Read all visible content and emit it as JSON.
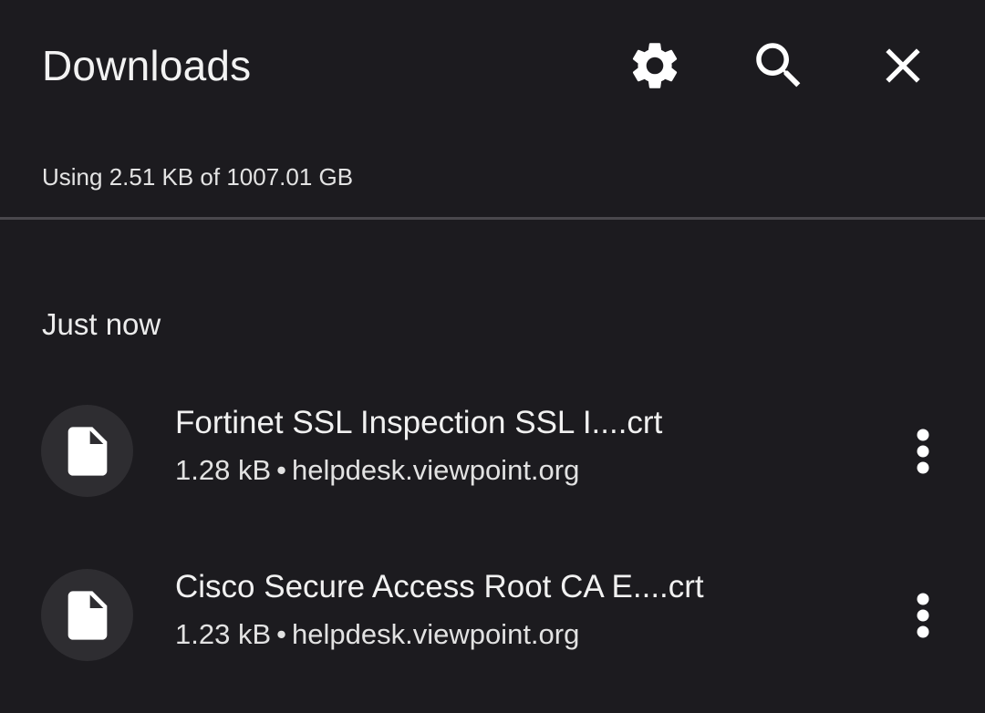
{
  "header": {
    "title": "Downloads",
    "settings_icon": "gear-icon",
    "search_icon": "search-icon",
    "close_icon": "close-icon"
  },
  "storage": {
    "text": "Using 2.51 KB of 1007.01 GB"
  },
  "sections": [
    {
      "label": "Just now",
      "items": [
        {
          "name": "Fortinet SSL Inspection SSL I....crt",
          "size": "1.28 kB",
          "separator": "•",
          "source": "helpdesk.viewpoint.org",
          "icon": "file-icon",
          "menu_icon": "more-vert-icon"
        },
        {
          "name": "Cisco Secure Access Root CA E....crt",
          "size": "1.23 kB",
          "separator": "•",
          "source": "helpdesk.viewpoint.org",
          "icon": "file-icon",
          "menu_icon": "more-vert-icon"
        }
      ]
    }
  ],
  "colors": {
    "background": "#1c1b1f",
    "divider": "#4a484d",
    "avatar": "#2e2d31",
    "text": "#f1f1f1"
  }
}
